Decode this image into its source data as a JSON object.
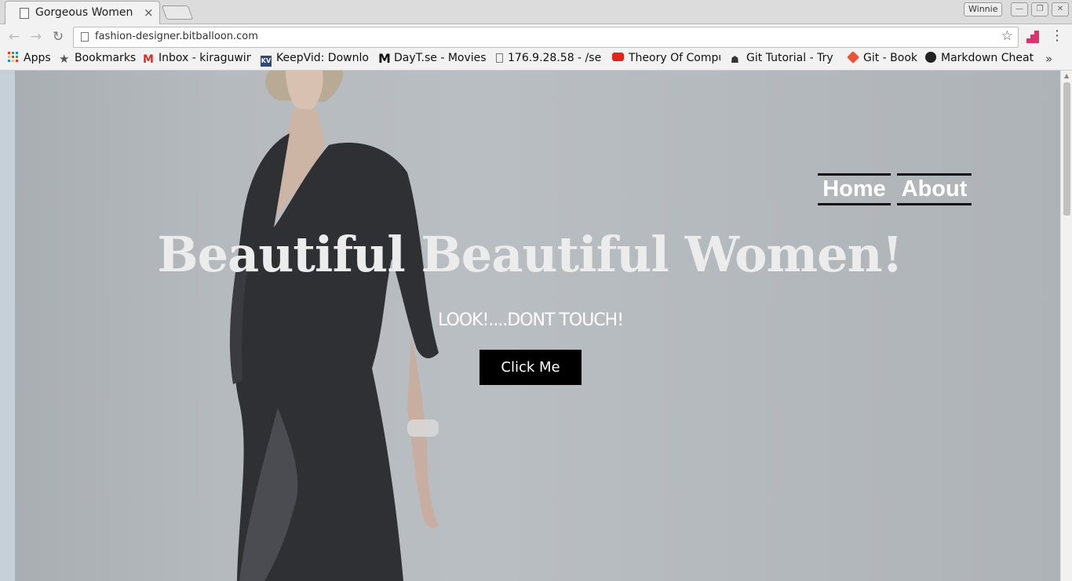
{
  "browser": {
    "tab_title": "Gorgeous Women",
    "tab_close": "×",
    "profile_name": "Winnie",
    "window_controls": [
      "—",
      "❐",
      "✕"
    ],
    "url": "fashion-designer.bitballoon.com"
  },
  "bookmarks": [
    {
      "label": "Apps",
      "icon": "apps-grid-icon"
    },
    {
      "label": "Bookmarks",
      "icon": "star-icon"
    },
    {
      "label": "Inbox - kiraguwin",
      "icon": "gmail-icon"
    },
    {
      "label": "KeepVid: Downlo",
      "icon": "keepvid-icon"
    },
    {
      "label": "DayT.se - Movies",
      "icon": "dayt-icon"
    },
    {
      "label": "176.9.28.58 - /se",
      "icon": "page-icon"
    },
    {
      "label": "Theory Of Compu",
      "icon": "youtube-icon"
    },
    {
      "label": "Git Tutorial - Try",
      "icon": "codeschool-icon"
    },
    {
      "label": "Git - Book",
      "icon": "git-icon"
    },
    {
      "label": "Markdown Cheat",
      "icon": "github-icon"
    }
  ],
  "bookmarks_more": "»",
  "page": {
    "nav": [
      "Home",
      "About"
    ],
    "headline": "Beautiful Beautiful Women!",
    "subheading": "LOOK!....DONT TOUCH!",
    "cta_label": "Click Me"
  },
  "colors": {
    "cta_background": "#000000",
    "headline_color": "#ececec"
  }
}
